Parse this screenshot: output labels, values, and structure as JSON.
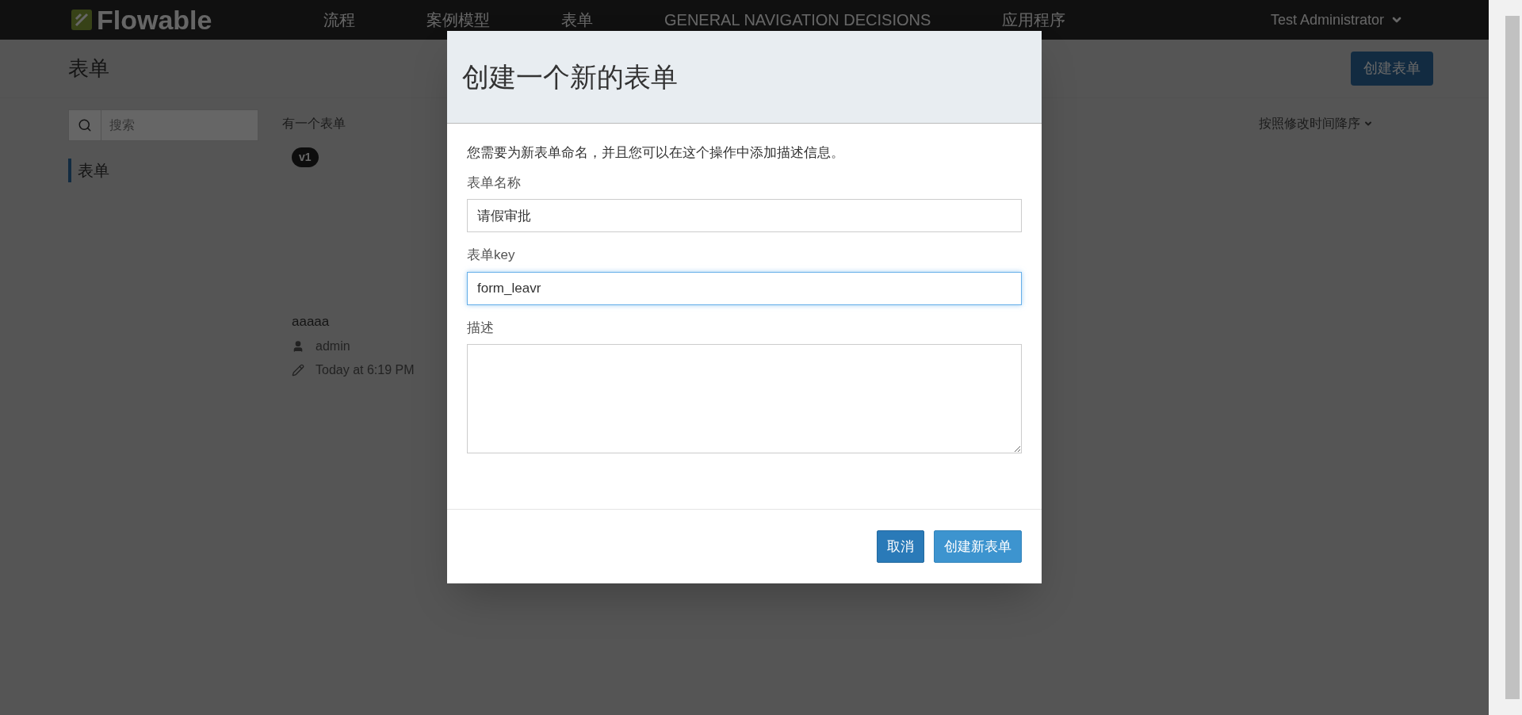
{
  "navbar": {
    "logo": "Flowable",
    "items": [
      {
        "label": "流程"
      },
      {
        "label": "案例模型"
      },
      {
        "label": "表单"
      },
      {
        "label": "GENERAL NAVIGATION DECISIONS"
      },
      {
        "label": "应用程序"
      }
    ],
    "user": "Test Administrator"
  },
  "page": {
    "title": "表单",
    "create_button": "创建表单",
    "search": {
      "placeholder": "搜索"
    },
    "sidebar": [
      {
        "label": "表单",
        "selected": true
      }
    ],
    "count_text": "有一个表单",
    "sort": "按照修改时间降序",
    "cards": [
      {
        "version": "v1",
        "name": "aaaaa",
        "author": "admin",
        "modified": "Today at 6:19 PM"
      }
    ]
  },
  "modal": {
    "title": "创建一个新的表单",
    "intro": "您需要为新表单命名，并且您可以在这个操作中添加描述信息。",
    "fields": [
      {
        "kind": "input",
        "label": "表单名称",
        "value": "请假审批",
        "focused": false
      },
      {
        "kind": "input",
        "label": "表单key",
        "value": "form_leavr",
        "focused": true
      },
      {
        "kind": "textarea",
        "label": "描述",
        "focused": false
      }
    ],
    "buttons": [
      {
        "label": "取消",
        "kind": "primary"
      },
      {
        "label": "创建新表单",
        "kind": "secondary"
      }
    ]
  }
}
